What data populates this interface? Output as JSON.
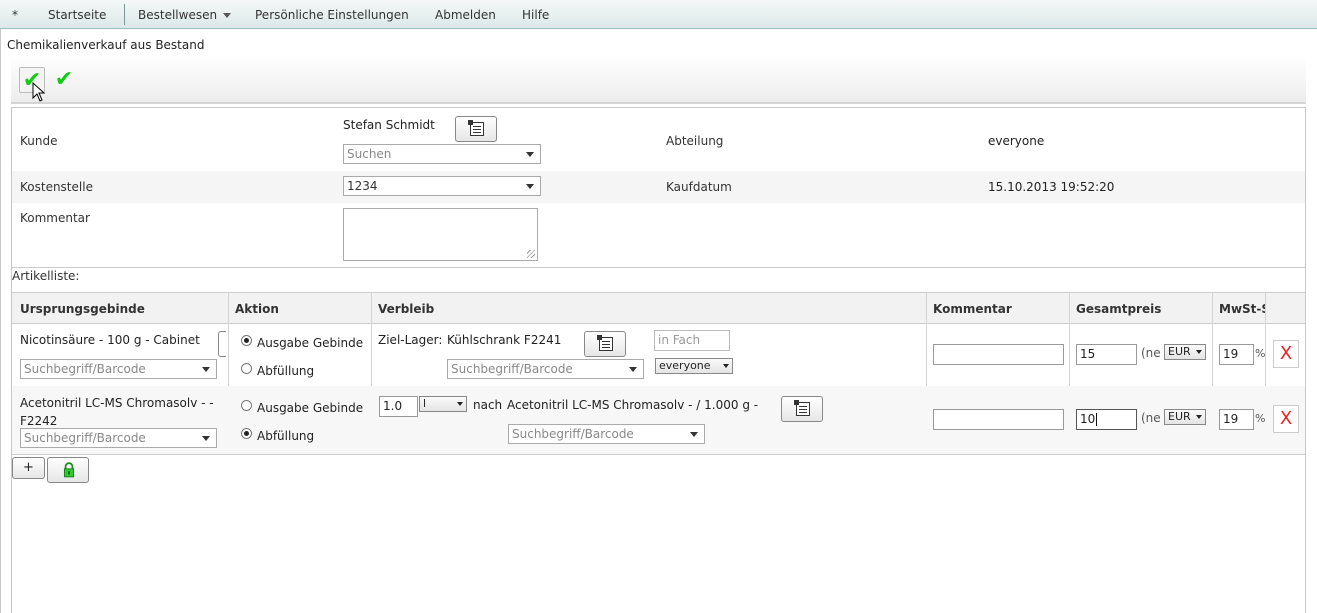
{
  "menu": {
    "star": "*",
    "items": [
      {
        "label": "Startseite"
      },
      {
        "label": "Bestellwesen",
        "has_dropdown": true
      },
      {
        "label": "Persönliche Einstellungen"
      },
      {
        "label": "Abmelden"
      },
      {
        "label": "Hilfe"
      }
    ]
  },
  "page": {
    "title": "Chemikalienverkauf aus Bestand"
  },
  "toolbar": {
    "buttons": [
      {
        "icon": "check-icon",
        "state": "hovered"
      },
      {
        "icon": "check-icon"
      }
    ],
    "accent": "#11cc11"
  },
  "form": {
    "kunde_label": "Kunde",
    "kunde_value": "Stefan Schmidt",
    "kunde_search_placeholder": "Suchen",
    "abteilung_label": "Abteilung",
    "abteilung_value": "everyone",
    "kostenstelle_label": "Kostenstelle",
    "kostenstelle_value": "1234",
    "kaufdatum_label": "Kaufdatum",
    "kaufdatum_value": "15.10.2013 19:52:20",
    "kommentar_label": "Kommentar",
    "kommentar_value": ""
  },
  "artikelliste": {
    "label": "Artikelliste:",
    "columns": [
      "Ursprungsgebinde",
      "Aktion",
      "Verbleib",
      "Kommentar",
      "Gesamtpreis",
      "MwSt-S"
    ],
    "rows": [
      {
        "ursprung": "Nicotinsäure - 100 g - Cabinet",
        "ursprung_search_placeholder": "Suchbegriff/Barcode",
        "aktion_option_1": "Ausgabe Gebinde",
        "aktion_option_2": "Abfüllung",
        "aktion_selected": "Ausgabe Gebinde",
        "ziel_label": "Ziel-Lager:",
        "ziel_value": "Kühlschrank F2241",
        "fach_placeholder": "in Fach",
        "verbleib_search_placeholder": "Suchbegriff/Barcode",
        "abteilung_select": "everyone",
        "kommentar": "",
        "preis": "15",
        "netto_prefix": "(ne",
        "currency": "EUR",
        "mwst": "19",
        "percent": "%",
        "delete": "X"
      },
      {
        "ursprung": "Acetonitril LC-MS Chromasolv - - F2242",
        "ursprung_search_placeholder": "Suchbegriff/Barcode",
        "aktion_option_1": "Ausgabe Gebinde",
        "aktion_option_2": "Abfüllung",
        "aktion_selected": "Abfüllung",
        "menge": "1.0",
        "einheit": "l",
        "nach_label": "nach",
        "ziel_value": "Acetonitril LC-MS Chromasolv - / 1.000 g -",
        "verbleib_search_placeholder": "Suchbegriff/Barcode",
        "kommentar": "",
        "preis": "10",
        "netto_prefix": "(ne",
        "currency": "EUR",
        "mwst": "19",
        "percent": "%",
        "delete": "X"
      }
    ],
    "add_button": "+",
    "lock_icon": "lock-icon"
  }
}
